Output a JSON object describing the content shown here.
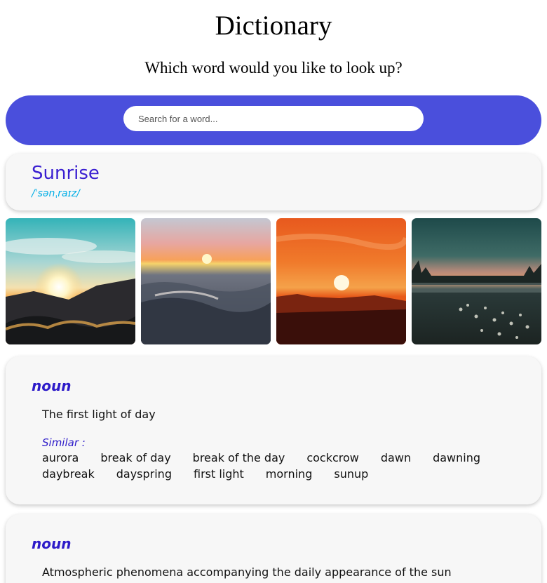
{
  "header": {
    "title": "Dictionary",
    "subtitle": "Which word would you like to look up?"
  },
  "search": {
    "placeholder": "Search for a word...",
    "value": ""
  },
  "entry": {
    "word": "Sunrise",
    "phonetic": "/ˈsənˌraɪz/"
  },
  "meanings": [
    {
      "part_of_speech": "noun",
      "definition": "The first light of day",
      "similar_label": "Similar :",
      "synonyms": [
        "aurora",
        "break of day",
        "break of the day",
        "cockcrow",
        "dawn",
        "dawning",
        "daybreak",
        "dayspring",
        "first light",
        "morning",
        "sunup"
      ]
    },
    {
      "part_of_speech": "noun",
      "definition": "Atmospheric phenomena accompanying the daily appearance of the sun"
    }
  ],
  "colors": {
    "accent": "#4a4fdc",
    "word": "#3a1fd1",
    "phonetic": "#00aee6",
    "card_bg": "#f7f7f7"
  }
}
